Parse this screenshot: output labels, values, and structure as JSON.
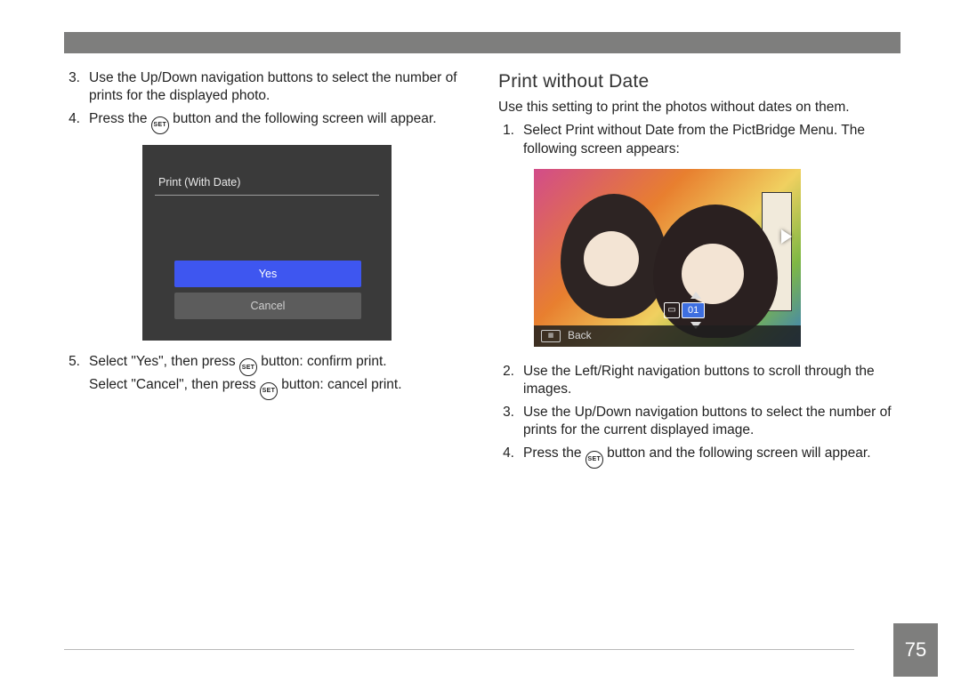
{
  "page_number": "75",
  "left": {
    "items": [
      {
        "num": "3.",
        "text": "Use the Up/Down navigation buttons to select the number of prints for the displayed photo."
      },
      {
        "num": "4.",
        "pre": "Press the ",
        "icon": "SET",
        "post": " button and the following screen will appear."
      },
      {
        "num": "5.",
        "l1_pre": "Select \"Yes\", then press ",
        "l1_icon": "SET",
        "l1_post": " button: confirm print.",
        "l2_pre": "Select \"Cancel\", then press ",
        "l2_icon": "SET",
        "l2_post": " button: cancel print."
      }
    ],
    "screen": {
      "title": "Print (With Date)",
      "option_yes": "Yes",
      "option_cancel": "Cancel"
    }
  },
  "right": {
    "heading": "Print without Date",
    "intro": "Use this setting to print the photos without dates on them.",
    "items": [
      {
        "num": "1.",
        "text": "Select Print without Date from the PictBridge Menu. The following screen appears:"
      },
      {
        "num": "2.",
        "text": "Use the Left/Right navigation buttons to scroll through the images."
      },
      {
        "num": "3.",
        "text": "Use the Up/Down navigation buttons to select the number of prints for the current displayed image."
      },
      {
        "num": "4.",
        "pre": "Press the ",
        "icon": "SET",
        "post": " button and the following screen will appear."
      }
    ],
    "screen": {
      "count": "01",
      "back_label": "Back"
    }
  }
}
